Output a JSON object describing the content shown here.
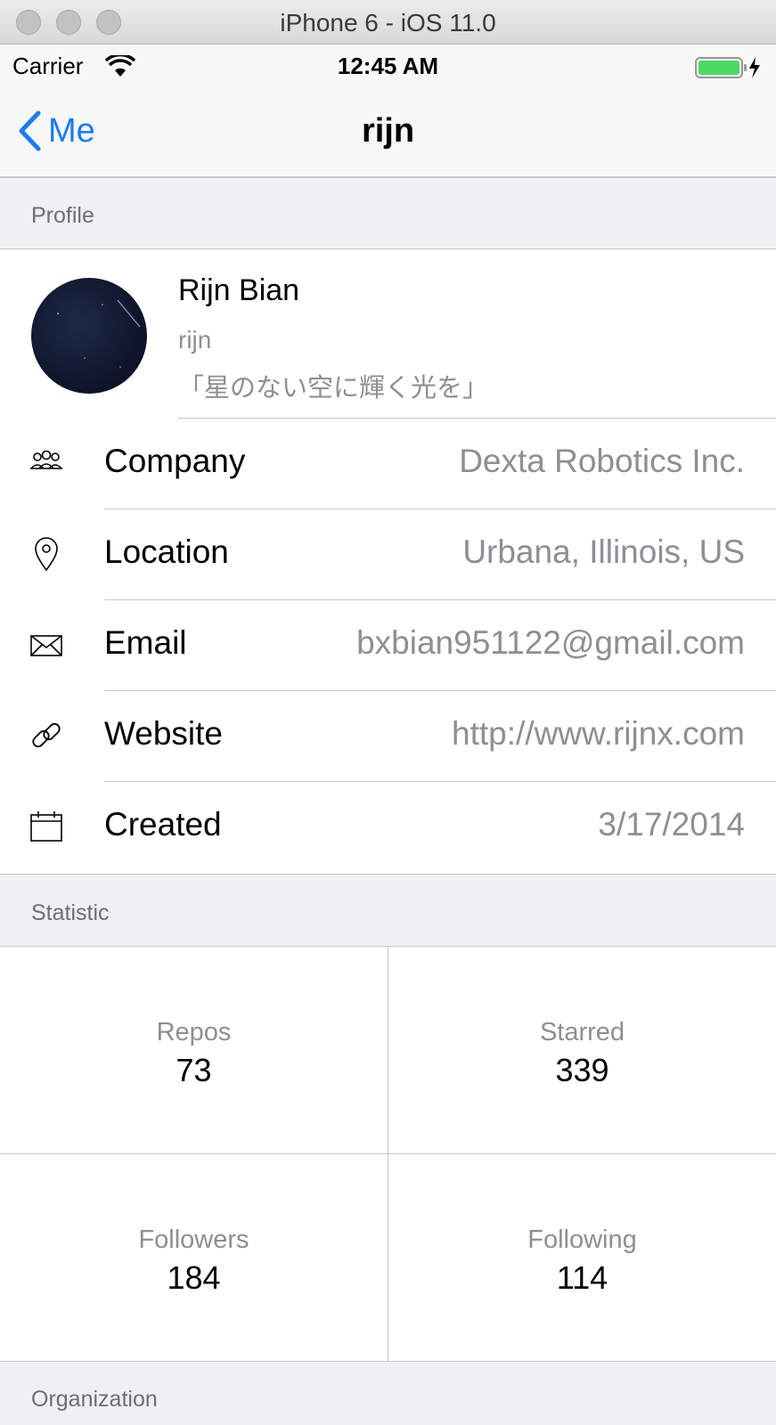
{
  "simulator": {
    "title": "iPhone 6 - iOS 11.0"
  },
  "status_bar": {
    "carrier": "Carrier",
    "time": "12:45 AM"
  },
  "nav": {
    "back_label": "Me",
    "title": "rijn"
  },
  "sections": {
    "profile": "Profile",
    "statistic": "Statistic",
    "organization": "Organization"
  },
  "profile": {
    "name": "Rijn Bian",
    "login": "rijn",
    "bio": "「星のない空に輝く光を」"
  },
  "info_rows": [
    {
      "label": "Company",
      "value": "Dexta Robotics Inc.",
      "icon": "people-icon"
    },
    {
      "label": "Location",
      "value": "Urbana, Illinois, US",
      "icon": "location-pin-icon"
    },
    {
      "label": "Email",
      "value": "bxbian951122@gmail.com",
      "icon": "envelope-icon"
    },
    {
      "label": "Website",
      "value": "http://www.rijnx.com",
      "icon": "link-icon"
    },
    {
      "label": "Created",
      "value": "3/17/2014",
      "icon": "calendar-icon"
    }
  ],
  "stats": [
    {
      "label": "Repos",
      "value": "73"
    },
    {
      "label": "Starred",
      "value": "339"
    },
    {
      "label": "Followers",
      "value": "184"
    },
    {
      "label": "Following",
      "value": "114"
    }
  ],
  "colors": {
    "accent": "#1a7cf4",
    "battery": "#4cd964",
    "section_bg": "#efeff4",
    "secondary_text": "#8e8e93"
  }
}
